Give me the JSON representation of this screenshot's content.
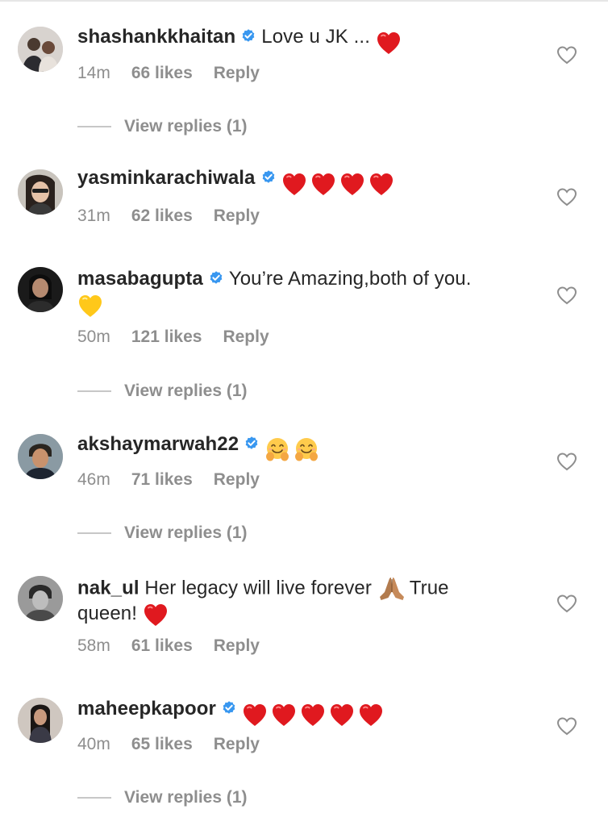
{
  "comments": [
    {
      "username": "shashankkhaitan",
      "verified": true,
      "text": "Love u JK ... ",
      "emojis": [
        "heart"
      ],
      "time": "14m",
      "likes": "66 likes",
      "reply_label": "Reply",
      "view_replies": "View replies (1)"
    },
    {
      "username": "yasminkarachiwala",
      "verified": true,
      "text": "",
      "emojis": [
        "heart",
        "heart",
        "heart",
        "heart"
      ],
      "time": "31m",
      "likes": "62 likes",
      "reply_label": "Reply"
    },
    {
      "username": "masabagupta",
      "verified": true,
      "text": "You’re Amazing,both of you.",
      "emojis": [
        "yellow-heart"
      ],
      "time": "50m",
      "likes": "121 likes",
      "reply_label": "Reply",
      "view_replies": "View replies (1)"
    },
    {
      "username": "akshaymarwah22",
      "verified": true,
      "text": "",
      "emojis": [
        "hugging-face",
        "hugging-face"
      ],
      "time": "46m",
      "likes": "71 likes",
      "reply_label": "Reply",
      "view_replies": "View replies (1)"
    },
    {
      "username": "nak_ul",
      "verified": false,
      "text_line1": "Her legacy will live forever",
      "text_line1_after": "True",
      "text_line2": "queen!",
      "emojis": [
        "folded-hands",
        "heart"
      ],
      "time": "58m",
      "likes": "61 likes",
      "reply_label": "Reply"
    },
    {
      "username": "maheepkapoor",
      "verified": true,
      "text": "",
      "emojis": [
        "heart",
        "heart",
        "heart",
        "heart",
        "heart"
      ],
      "time": "40m",
      "likes": "65 likes",
      "reply_label": "Reply",
      "view_replies": "View replies (1)"
    }
  ],
  "colors": {
    "text": "#262626",
    "meta": "#8e8e8e",
    "verified": "#3897f0",
    "heart": "#ed1c24",
    "yellow_heart": "#ffcc1f"
  }
}
